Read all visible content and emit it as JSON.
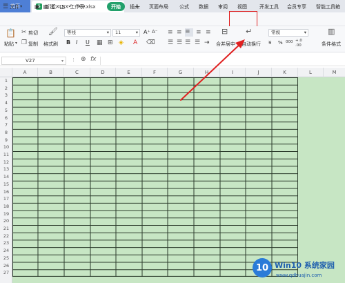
{
  "titlebar": {
    "home_tab": "首页",
    "doc_tab": "新建 XLSX 工作表.xlsx",
    "new_tab": "+"
  },
  "menubar": {
    "file": "文件",
    "items": [
      "开始",
      "插入",
      "页面布局",
      "公式",
      "数据",
      "审阅",
      "视图",
      "开发工具",
      "会员专享",
      "智能工具箱"
    ]
  },
  "toolbar": {
    "paste": "粘贴",
    "cut": "剪切",
    "copy": "复制",
    "format_painter": "格式刷",
    "font_name": "等线",
    "font_size": "11",
    "bold": "B",
    "italic": "I",
    "underline": "U",
    "merge_center": "合并居中",
    "wrap_text": "自动换行",
    "number_format": "常规",
    "percent": "%",
    "thousands": "000",
    "dec_inc": "+.0",
    "dec_dec": ".00",
    "currency": "¥",
    "conditional_format": "条件格式"
  },
  "formula_bar": {
    "cell_ref": "V27",
    "fx": "fx"
  },
  "sheet": {
    "columns": [
      "A",
      "B",
      "C",
      "D",
      "E",
      "F",
      "G",
      "H",
      "I",
      "J",
      "K",
      "L",
      "M"
    ],
    "rows": [
      "1",
      "2",
      "3",
      "4",
      "5",
      "6",
      "7",
      "8",
      "9",
      "10",
      "11",
      "12",
      "13",
      "14",
      "15",
      "16",
      "17",
      "18",
      "19",
      "20",
      "21",
      "22",
      "23",
      "24",
      "25",
      "26",
      "27"
    ]
  },
  "watermark": {
    "brand": "Win10 系统家园",
    "url": "www.qdhuajin.com"
  },
  "colors": {
    "accent_green": "#22a06b",
    "cell_fill": "#c7e6c4",
    "highlight_red": "#e02020",
    "home_blue": "#4e7fd6"
  }
}
